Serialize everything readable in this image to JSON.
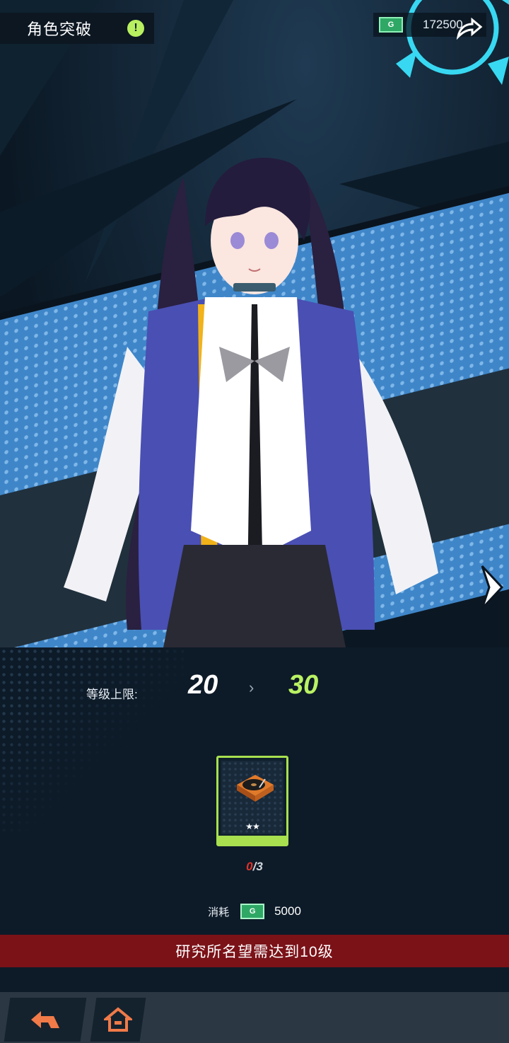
{
  "header": {
    "title": "角色突破",
    "alert_icon": "!"
  },
  "currency": {
    "icon": "G",
    "amount": "172500"
  },
  "breakthrough": {
    "level_label": "等级上限:",
    "level_from": "20",
    "level_arrow": "›",
    "level_to": "30"
  },
  "material": {
    "name": "turntable-icon",
    "rarity_stars": "★★",
    "have": "0",
    "need": "/3"
  },
  "cost": {
    "label": "消耗",
    "icon": "G",
    "value": "5000"
  },
  "warning": "研究所名望需达到10级",
  "colors": {
    "accent_green": "#b9f263",
    "warning_red": "#7a1218",
    "band_blue": "#3f86c9"
  }
}
